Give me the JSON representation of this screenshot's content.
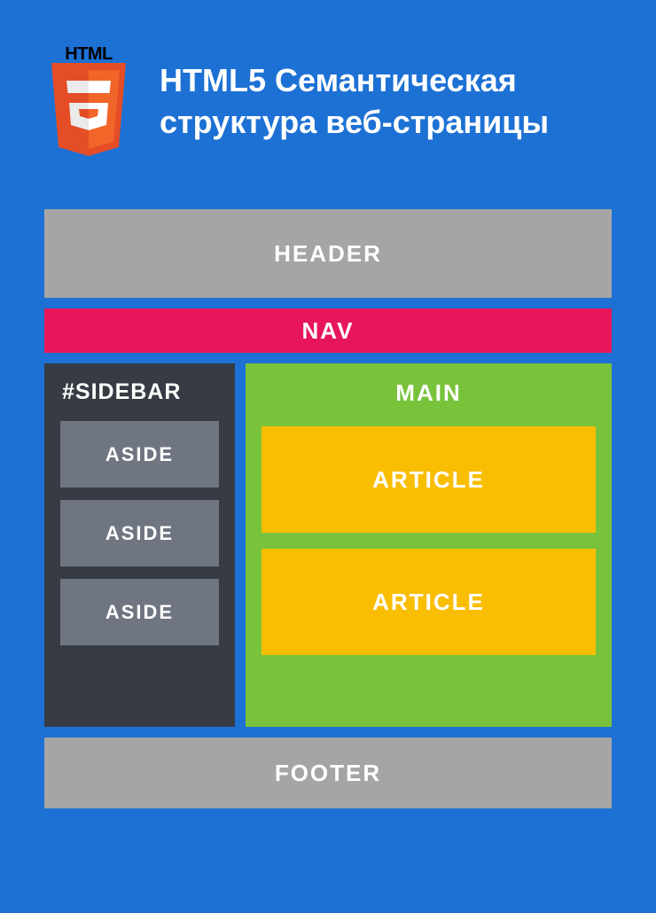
{
  "logo": {
    "top_text": "HTML",
    "numeral": "5"
  },
  "title": "HTML5 Семантическая структура веб-страницы",
  "blocks": {
    "header": "HEADER",
    "nav": "NAV",
    "sidebar_label": "#SIDEBAR",
    "asides": [
      "ASIDE",
      "ASIDE",
      "ASIDE"
    ],
    "main_label": "MAIN",
    "articles": [
      "ARTICLE",
      "ARTICLE"
    ],
    "footer": "FOOTER"
  },
  "colors": {
    "background": "#1d71d4",
    "header_footer": "#a5a5a5",
    "nav": "#e7165b",
    "sidebar": "#363b44",
    "aside": "#6f7581",
    "main": "#79c33c",
    "article": "#f9be02",
    "logo_orange": "#e44d26",
    "logo_light": "#f16529"
  }
}
